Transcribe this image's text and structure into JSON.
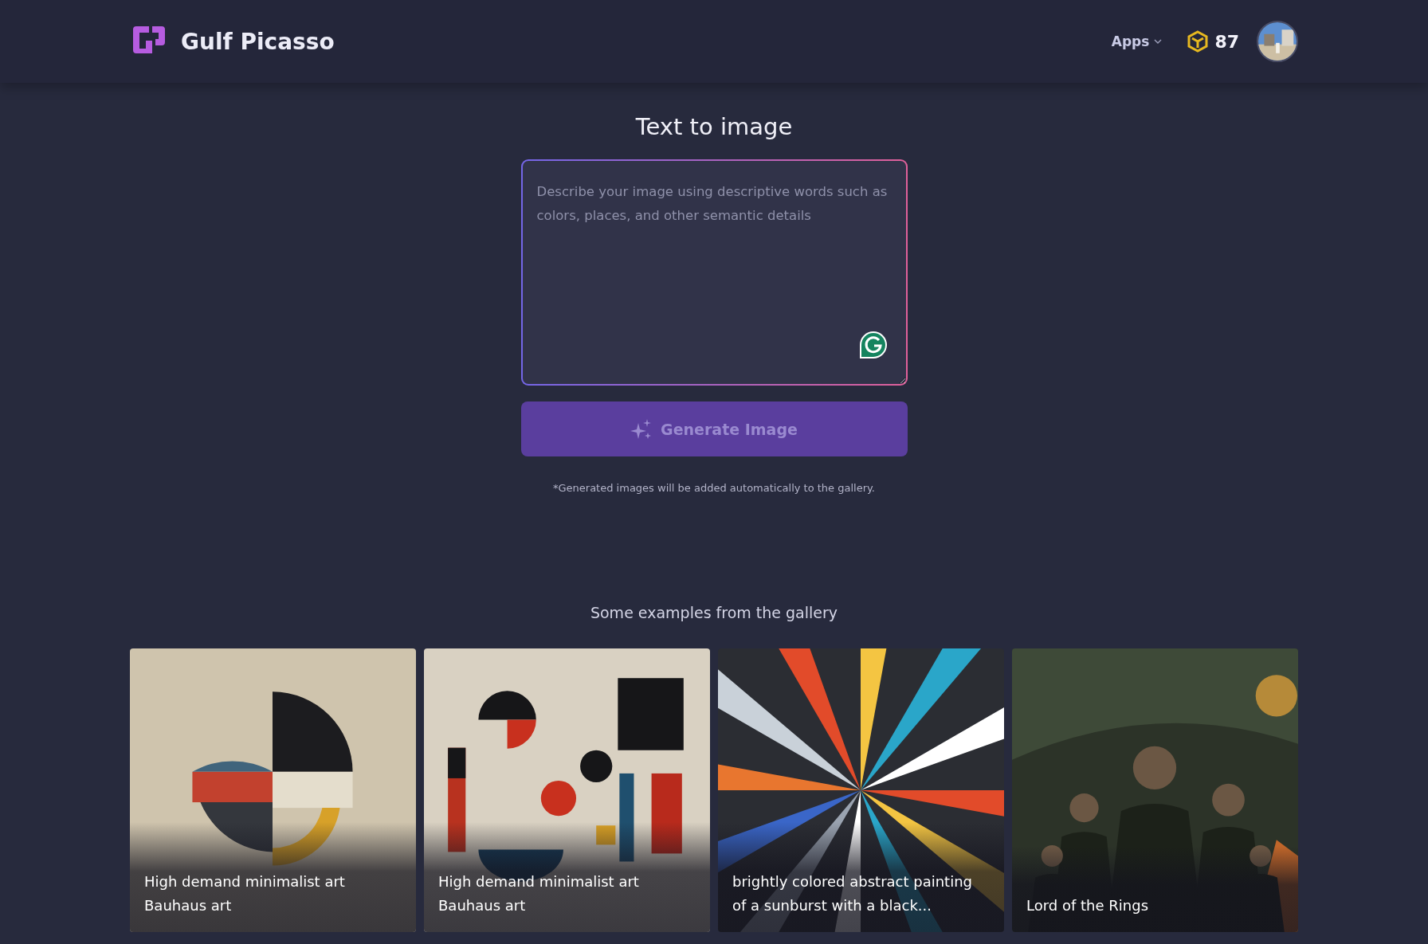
{
  "header": {
    "brand": "Gulf Picasso",
    "apps_menu": "Apps",
    "credits": "87"
  },
  "composer": {
    "title": "Text to image",
    "prompt": {
      "placeholder": "Describe your image using descriptive words such as colors, places, and other semantic details"
    },
    "generate_button": {
      "label": "Generate Image",
      "disabled": true
    },
    "note": "*Generated images will be added automatically to the gallery."
  },
  "gallery": {
    "heading": "Some examples from the gallery",
    "items": [
      {
        "caption": "High demand minimalist art Bauhaus art"
      },
      {
        "caption": "High demand minimalist art Bauhaus art"
      },
      {
        "caption": "brightly colored abstract painting of a sunburst with a black..."
      },
      {
        "caption": "Lord of the Rings"
      }
    ]
  }
}
